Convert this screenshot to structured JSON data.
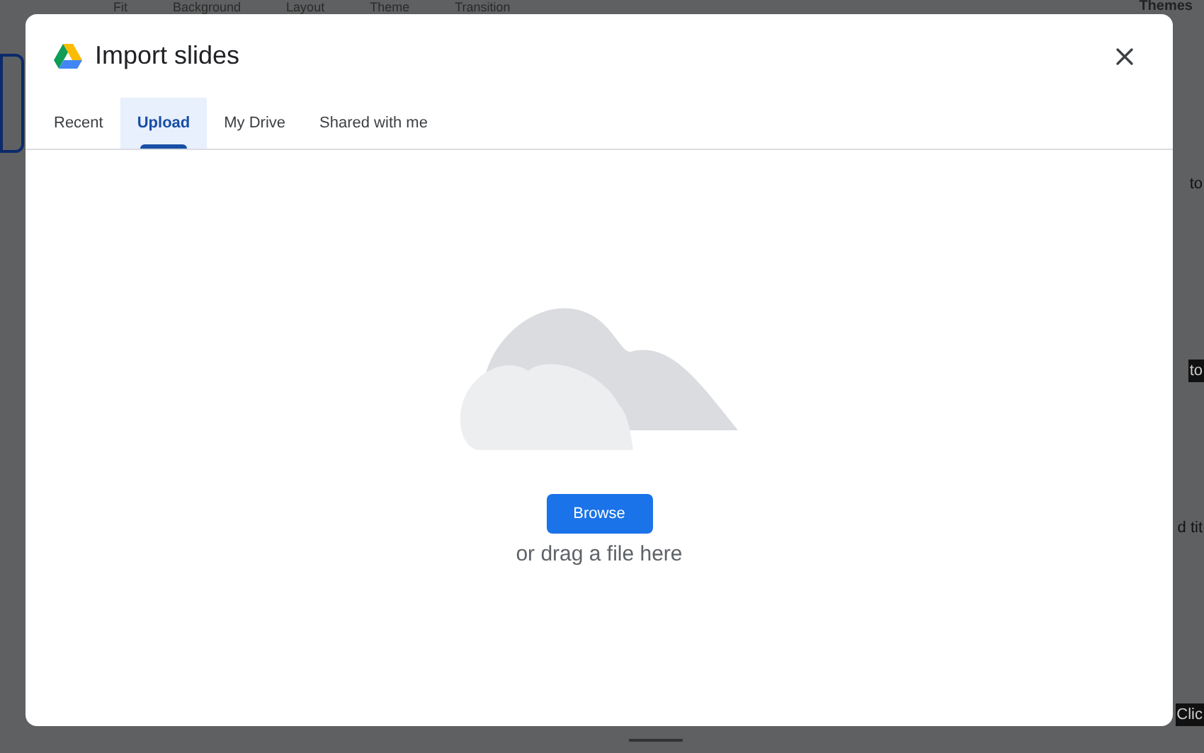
{
  "background": {
    "toolbar": [
      "Fit",
      "Background",
      "Layout",
      "Theme",
      "Transition"
    ],
    "themes_title": "Themes",
    "side_texts": [
      {
        "text": "to",
        "kind": "light"
      },
      {
        "text": "to",
        "kind": "dark"
      },
      {
        "text": "d tit",
        "kind": "light"
      },
      {
        "text": "Clic",
        "kind": "dark"
      }
    ]
  },
  "dialog": {
    "title": "Import slides",
    "tabs": [
      {
        "label": "Recent",
        "selected": false
      },
      {
        "label": "Upload",
        "selected": true
      },
      {
        "label": "My Drive",
        "selected": false
      },
      {
        "label": "Shared with me",
        "selected": false
      }
    ],
    "browse_button": "Browse",
    "drop_hint": "or drag a file here"
  }
}
